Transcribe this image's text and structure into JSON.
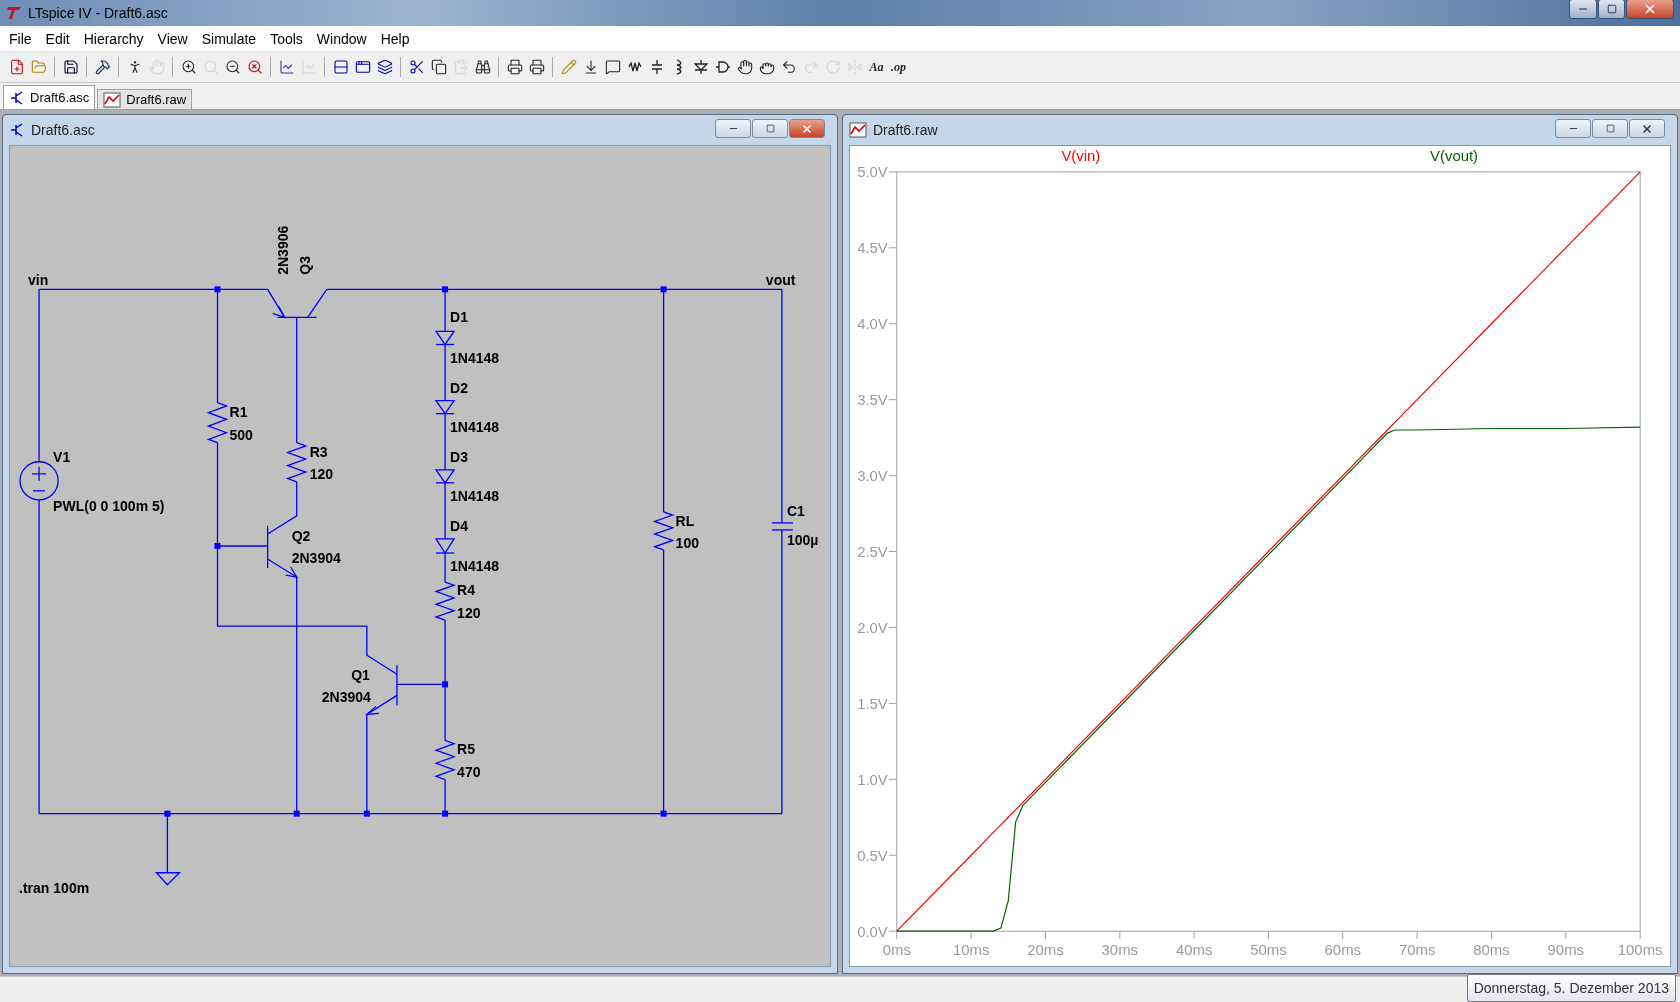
{
  "window": {
    "title": "LTspice IV - Draft6.asc"
  },
  "menu": [
    "File",
    "Edit",
    "Hierarchy",
    "View",
    "Simulate",
    "Tools",
    "Window",
    "Help"
  ],
  "toolbar": [
    {
      "disabled": false
    },
    {
      "disabled": false
    },
    {
      "disabled": false
    },
    {
      "disabled": false
    },
    {
      "disabled": false
    },
    {
      "disabled": true
    },
    {
      "disabled": false
    },
    {
      "disabled": true
    },
    {
      "disabled": false
    },
    {
      "disabled": false
    },
    {
      "disabled": false
    },
    {
      "disabled": true
    },
    {
      "disabled": false
    },
    {
      "disabled": false
    },
    {
      "disabled": false
    },
    {
      "disabled": false
    },
    {
      "disabled": false
    },
    {
      "disabled": true
    },
    {
      "disabled": false
    },
    {
      "disabled": false
    },
    {
      "disabled": false
    },
    {
      "disabled": false
    },
    {
      "disabled": false
    },
    {
      "disabled": false
    },
    {
      "disabled": false
    },
    {
      "disabled": false
    },
    {
      "disabled": false
    },
    {
      "disabled": false
    },
    {
      "disabled": false
    },
    {
      "disabled": false
    },
    {
      "disabled": false
    },
    {
      "disabled": false
    },
    {
      "disabled": true
    },
    {
      "disabled": true
    },
    {
      "disabled": true
    },
    {
      "label": "Aa",
      "disabled": false
    },
    {
      "label": ".op",
      "disabled": false
    }
  ],
  "tabs": [
    {
      "label": "Draft6.asc",
      "selected": true
    },
    {
      "label": "Draft6.raw",
      "selected": false
    }
  ],
  "schematic_window": {
    "title": "Draft6.asc",
    "net_labels": [
      "vin",
      "vout"
    ],
    "components": [
      {
        "name": "Q3",
        "value": "2N3906"
      },
      {
        "name": "R1",
        "value": "500"
      },
      {
        "name": "V1",
        "value": "PWL(0 0 100m 5)"
      },
      {
        "name": "R3",
        "value": "120"
      },
      {
        "name": "Q2",
        "value": "2N3904"
      },
      {
        "name": "D1",
        "value": "1N4148"
      },
      {
        "name": "D2",
        "value": "1N4148"
      },
      {
        "name": "D3",
        "value": "1N4148"
      },
      {
        "name": "D4",
        "value": "1N4148"
      },
      {
        "name": "R4",
        "value": "120"
      },
      {
        "name": "Q1",
        "value": "2N3904"
      },
      {
        "name": "R5",
        "value": "470"
      },
      {
        "name": "RL",
        "value": "100"
      },
      {
        "name": "C1",
        "value": "100µ"
      }
    ],
    "directive": ".tran 100m"
  },
  "plot_window": {
    "title": "Draft6.raw",
    "chart_data": {
      "type": "line",
      "x": [
        0,
        10,
        13,
        14,
        15,
        16,
        17,
        20,
        30,
        40,
        50,
        60,
        66,
        67,
        70,
        80,
        90,
        100
      ],
      "series": [
        {
          "name": "V(vin)",
          "color": "#ff0000",
          "values": [
            0,
            0.5,
            0.65,
            0.7,
            0.75,
            0.8,
            0.85,
            1,
            1.5,
            2,
            2.5,
            3,
            3.3,
            3.35,
            3.5,
            4,
            4.5,
            5
          ]
        },
        {
          "name": "V(vout)",
          "color": "#006400",
          "values": [
            0,
            0,
            0,
            0.02,
            0.2,
            0.72,
            0.83,
            0.98,
            1.48,
            1.98,
            2.48,
            2.98,
            3.28,
            3.3,
            3.3,
            3.31,
            3.31,
            3.32
          ]
        }
      ],
      "xlim": [
        0,
        100
      ],
      "ylim": [
        0,
        5
      ],
      "xticks": [
        {
          "value": 0,
          "label": "0ms"
        },
        {
          "value": 10,
          "label": "10ms"
        },
        {
          "value": 20,
          "label": "20ms"
        },
        {
          "value": 30,
          "label": "30ms"
        },
        {
          "value": 40,
          "label": "40ms"
        },
        {
          "value": 50,
          "label": "50ms"
        },
        {
          "value": 60,
          "label": "60ms"
        },
        {
          "value": 70,
          "label": "70ms"
        },
        {
          "value": 80,
          "label": "80ms"
        },
        {
          "value": 90,
          "label": "90ms"
        },
        {
          "value": 100,
          "label": "100ms"
        }
      ],
      "yticks": [
        {
          "value": 0,
          "label": "0.0V"
        },
        {
          "value": 0.5,
          "label": "0.5V"
        },
        {
          "value": 1,
          "label": "1.0V"
        },
        {
          "value": 1.5,
          "label": "1.5V"
        },
        {
          "value": 2,
          "label": "2.0V"
        },
        {
          "value": 2.5,
          "label": "2.5V"
        },
        {
          "value": 3,
          "label": "3.0V"
        },
        {
          "value": 3.5,
          "label": "3.5V"
        },
        {
          "value": 4,
          "label": "4.0V"
        },
        {
          "value": 4.5,
          "label": "4.5V"
        },
        {
          "value": 5,
          "label": "5.0V"
        }
      ]
    }
  },
  "status_bar": {
    "tooltip": "Donnerstag, 5. Dezember 2013"
  }
}
